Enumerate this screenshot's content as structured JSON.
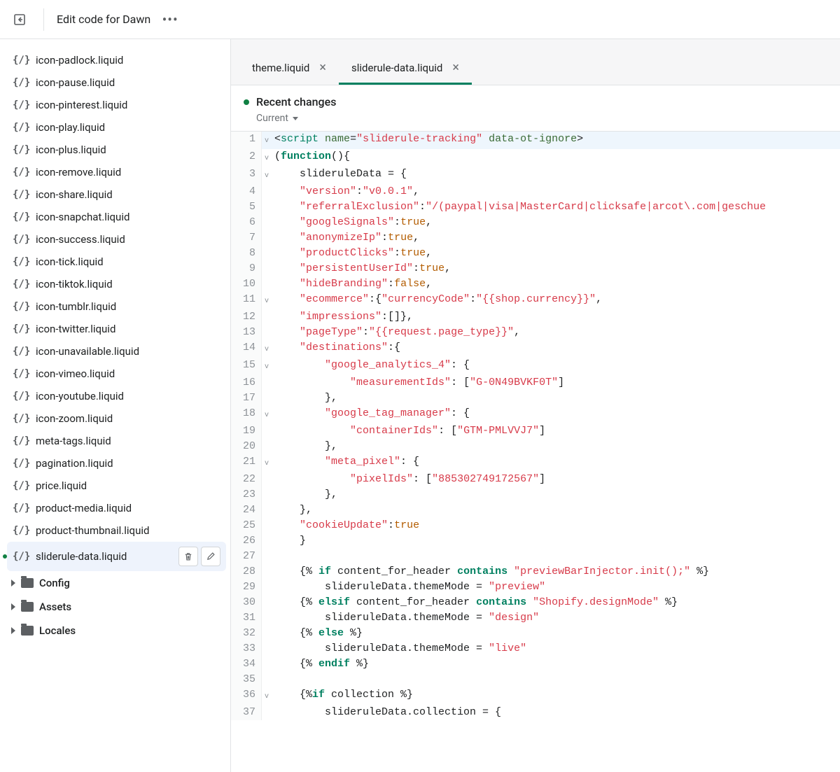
{
  "topbar": {
    "title": "Edit code for Dawn"
  },
  "sidebar": {
    "files": [
      "icon-padlock.liquid",
      "icon-pause.liquid",
      "icon-pinterest.liquid",
      "icon-play.liquid",
      "icon-plus.liquid",
      "icon-remove.liquid",
      "icon-share.liquid",
      "icon-snapchat.liquid",
      "icon-success.liquid",
      "icon-tick.liquid",
      "icon-tiktok.liquid",
      "icon-tumblr.liquid",
      "icon-twitter.liquid",
      "icon-unavailable.liquid",
      "icon-vimeo.liquid",
      "icon-youtube.liquid",
      "icon-zoom.liquid",
      "meta-tags.liquid",
      "pagination.liquid",
      "price.liquid",
      "product-media.liquid",
      "product-thumbnail.liquid",
      "sliderule-data.liquid"
    ],
    "selected": "sliderule-data.liquid",
    "folders": [
      "Config",
      "Assets",
      "Locales"
    ]
  },
  "tabs": {
    "items": [
      {
        "label": "theme.liquid",
        "active": false
      },
      {
        "label": "sliderule-data.liquid",
        "active": true
      }
    ]
  },
  "recent": {
    "title": "Recent changes",
    "current": "Current"
  },
  "code": {
    "lines": [
      {
        "n": 1,
        "fold": "v",
        "hl": true,
        "tokens": [
          [
            "plain",
            "<"
          ],
          [
            "tag",
            "script"
          ],
          [
            "plain",
            " "
          ],
          [
            "attr",
            "name"
          ],
          [
            "plain",
            "="
          ],
          [
            "str",
            "\"sliderule-tracking\""
          ],
          [
            "plain",
            " "
          ],
          [
            "attr",
            "data-ot-ignore"
          ],
          [
            "plain",
            ">"
          ]
        ]
      },
      {
        "n": 2,
        "fold": "v",
        "tokens": [
          [
            "plain",
            "("
          ],
          [
            "kw",
            "function"
          ],
          [
            "plain",
            "(){"
          ]
        ]
      },
      {
        "n": 3,
        "fold": "v",
        "tokens": [
          [
            "plain",
            "    slideruleData = {"
          ]
        ]
      },
      {
        "n": 4,
        "tokens": [
          [
            "plain",
            "    "
          ],
          [
            "str",
            "\"version\""
          ],
          [
            "plain",
            ":"
          ],
          [
            "str",
            "\"v0.0.1\""
          ],
          [
            "plain",
            ","
          ]
        ]
      },
      {
        "n": 5,
        "tokens": [
          [
            "plain",
            "    "
          ],
          [
            "str",
            "\"referralExclusion\""
          ],
          [
            "plain",
            ":"
          ],
          [
            "str",
            "\"/(paypal|visa|MasterCard|clicksafe|arcot\\.com|geschue"
          ]
        ]
      },
      {
        "n": 6,
        "tokens": [
          [
            "plain",
            "    "
          ],
          [
            "str",
            "\"googleSignals\""
          ],
          [
            "plain",
            ":"
          ],
          [
            "bool",
            "true"
          ],
          [
            "plain",
            ","
          ]
        ]
      },
      {
        "n": 7,
        "tokens": [
          [
            "plain",
            "    "
          ],
          [
            "str",
            "\"anonymizeIp\""
          ],
          [
            "plain",
            ":"
          ],
          [
            "bool",
            "true"
          ],
          [
            "plain",
            ","
          ]
        ]
      },
      {
        "n": 8,
        "tokens": [
          [
            "plain",
            "    "
          ],
          [
            "str",
            "\"productClicks\""
          ],
          [
            "plain",
            ":"
          ],
          [
            "bool",
            "true"
          ],
          [
            "plain",
            ","
          ]
        ]
      },
      {
        "n": 9,
        "tokens": [
          [
            "plain",
            "    "
          ],
          [
            "str",
            "\"persistentUserId\""
          ],
          [
            "plain",
            ":"
          ],
          [
            "bool",
            "true"
          ],
          [
            "plain",
            ","
          ]
        ]
      },
      {
        "n": 10,
        "tokens": [
          [
            "plain",
            "    "
          ],
          [
            "str",
            "\"hideBranding\""
          ],
          [
            "plain",
            ":"
          ],
          [
            "bool",
            "false"
          ],
          [
            "plain",
            ","
          ]
        ]
      },
      {
        "n": 11,
        "fold": "v",
        "tokens": [
          [
            "plain",
            "    "
          ],
          [
            "str",
            "\"ecommerce\""
          ],
          [
            "plain",
            ":{"
          ],
          [
            "str",
            "\"currencyCode\""
          ],
          [
            "plain",
            ":"
          ],
          [
            "str",
            "\"{{shop.currency}}\""
          ],
          [
            "plain",
            ","
          ]
        ]
      },
      {
        "n": 12,
        "tokens": [
          [
            "plain",
            "    "
          ],
          [
            "str",
            "\"impressions\""
          ],
          [
            "plain",
            ":[]},"
          ]
        ]
      },
      {
        "n": 13,
        "tokens": [
          [
            "plain",
            "    "
          ],
          [
            "str",
            "\"pageType\""
          ],
          [
            "plain",
            ":"
          ],
          [
            "str",
            "\"{{request.page_type}}\""
          ],
          [
            "plain",
            ","
          ]
        ]
      },
      {
        "n": 14,
        "fold": "v",
        "tokens": [
          [
            "plain",
            "    "
          ],
          [
            "str",
            "\"destinations\""
          ],
          [
            "plain",
            ":{"
          ]
        ]
      },
      {
        "n": 15,
        "fold": "v",
        "tokens": [
          [
            "plain",
            "        "
          ],
          [
            "str",
            "\"google_analytics_4\""
          ],
          [
            "plain",
            ": {"
          ]
        ]
      },
      {
        "n": 16,
        "tokens": [
          [
            "plain",
            "            "
          ],
          [
            "str",
            "\"measurementIds\""
          ],
          [
            "plain",
            ": ["
          ],
          [
            "str",
            "\"G-0N49BVKF0T\""
          ],
          [
            "plain",
            "]"
          ]
        ]
      },
      {
        "n": 17,
        "tokens": [
          [
            "plain",
            "        },"
          ]
        ]
      },
      {
        "n": 18,
        "fold": "v",
        "tokens": [
          [
            "plain",
            "        "
          ],
          [
            "str",
            "\"google_tag_manager\""
          ],
          [
            "plain",
            ": {"
          ]
        ]
      },
      {
        "n": 19,
        "tokens": [
          [
            "plain",
            "            "
          ],
          [
            "str",
            "\"containerIds\""
          ],
          [
            "plain",
            ": ["
          ],
          [
            "str",
            "\"GTM-PMLVVJ7\""
          ],
          [
            "plain",
            "]"
          ]
        ]
      },
      {
        "n": 20,
        "tokens": [
          [
            "plain",
            "        },"
          ]
        ]
      },
      {
        "n": 21,
        "fold": "v",
        "tokens": [
          [
            "plain",
            "        "
          ],
          [
            "str",
            "\"meta_pixel\""
          ],
          [
            "plain",
            ": {"
          ]
        ]
      },
      {
        "n": 22,
        "tokens": [
          [
            "plain",
            "            "
          ],
          [
            "str",
            "\"pixelIds\""
          ],
          [
            "plain",
            ": ["
          ],
          [
            "str",
            "\"885302749172567\""
          ],
          [
            "plain",
            "]"
          ]
        ]
      },
      {
        "n": 23,
        "tokens": [
          [
            "plain",
            "        },"
          ]
        ]
      },
      {
        "n": 24,
        "tokens": [
          [
            "plain",
            "    },"
          ]
        ]
      },
      {
        "n": 25,
        "tokens": [
          [
            "plain",
            "    "
          ],
          [
            "str",
            "\"cookieUpdate\""
          ],
          [
            "plain",
            ":"
          ],
          [
            "bool",
            "true"
          ]
        ]
      },
      {
        "n": 26,
        "tokens": [
          [
            "plain",
            "    }"
          ]
        ]
      },
      {
        "n": 27,
        "tokens": [
          [
            "plain",
            ""
          ]
        ]
      },
      {
        "n": 28,
        "tokens": [
          [
            "plain",
            "    {% "
          ],
          [
            "kw",
            "if"
          ],
          [
            "plain",
            " content_for_header "
          ],
          [
            "kw",
            "contains"
          ],
          [
            "plain",
            " "
          ],
          [
            "str",
            "\"previewBarInjector.init();\""
          ],
          [
            "plain",
            " %}"
          ]
        ]
      },
      {
        "n": 29,
        "tokens": [
          [
            "plain",
            "        slideruleData.themeMode = "
          ],
          [
            "str",
            "\"preview\""
          ]
        ]
      },
      {
        "n": 30,
        "tokens": [
          [
            "plain",
            "    {% "
          ],
          [
            "kw",
            "elsif"
          ],
          [
            "plain",
            " content_for_header "
          ],
          [
            "kw",
            "contains"
          ],
          [
            "plain",
            " "
          ],
          [
            "str",
            "\"Shopify.designMode\""
          ],
          [
            "plain",
            " %}"
          ]
        ]
      },
      {
        "n": 31,
        "tokens": [
          [
            "plain",
            "        slideruleData.themeMode = "
          ],
          [
            "str",
            "\"design\""
          ]
        ]
      },
      {
        "n": 32,
        "tokens": [
          [
            "plain",
            "    {% "
          ],
          [
            "kw",
            "else"
          ],
          [
            "plain",
            " %}"
          ]
        ]
      },
      {
        "n": 33,
        "tokens": [
          [
            "plain",
            "        slideruleData.themeMode = "
          ],
          [
            "str",
            "\"live\""
          ]
        ]
      },
      {
        "n": 34,
        "tokens": [
          [
            "plain",
            "    {% "
          ],
          [
            "kw",
            "endif"
          ],
          [
            "plain",
            " %}"
          ]
        ]
      },
      {
        "n": 35,
        "tokens": [
          [
            "plain",
            ""
          ]
        ]
      },
      {
        "n": 36,
        "fold": "v",
        "tokens": [
          [
            "plain",
            "    {%"
          ],
          [
            "kw",
            "if"
          ],
          [
            "plain",
            " collection %}"
          ]
        ]
      },
      {
        "n": 37,
        "tokens": [
          [
            "plain",
            "        slideruleData.collection = {"
          ]
        ]
      }
    ]
  }
}
